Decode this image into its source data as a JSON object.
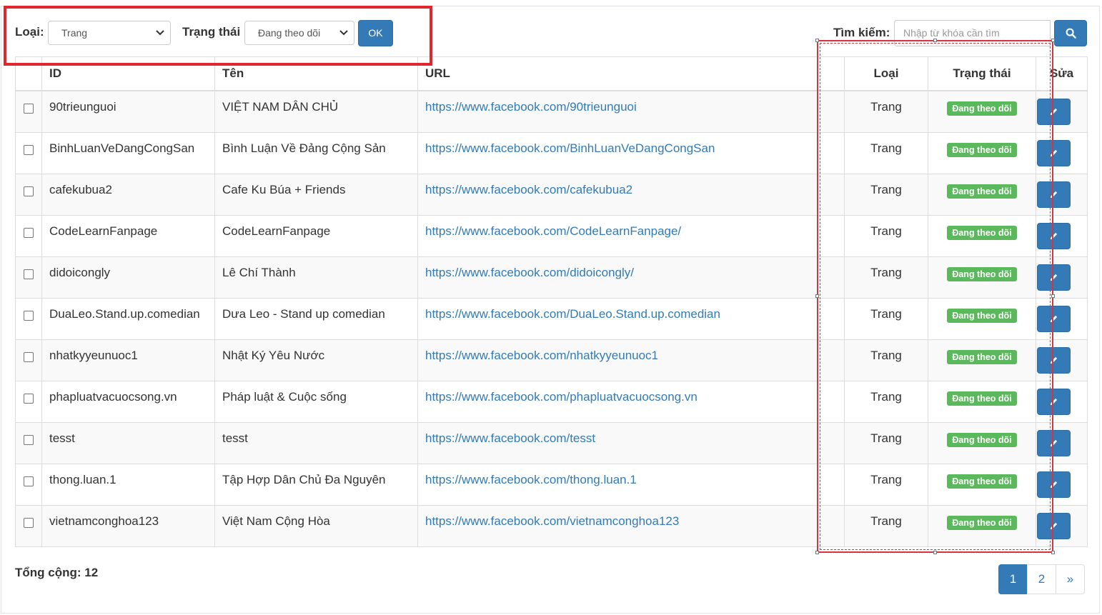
{
  "filters": {
    "type_label": "Loại:",
    "type_value": "Trang",
    "status_label": "Trạng thái",
    "status_value": "Đang theo dõi",
    "ok_label": "OK"
  },
  "search": {
    "label": "Tìm kiếm:",
    "placeholder": "Nhập từ khóa cần tìm"
  },
  "table": {
    "headers": {
      "id": "ID",
      "name": "Tên",
      "url": "URL",
      "type": "Loại",
      "status": "Trạng thái",
      "edit": "Sửa"
    },
    "rows": [
      {
        "id": "90trieunguoi",
        "name": "VIỆT NAM DÂN CHỦ",
        "url": "https://www.facebook.com/90trieunguoi",
        "type": "Trang",
        "status": "Đang theo dõi"
      },
      {
        "id": "BinhLuanVeDangCongSan",
        "name": "Bình Luận Về Đảng Cộng Sản",
        "url": "https://www.facebook.com/BinhLuanVeDangCongSan",
        "type": "Trang",
        "status": "Đang theo dõi"
      },
      {
        "id": "cafekubua2",
        "name": "Cafe Ku Búa + Friends",
        "url": "https://www.facebook.com/cafekubua2",
        "type": "Trang",
        "status": "Đang theo dõi"
      },
      {
        "id": "CodeLearnFanpage",
        "name": "CodeLearnFanpage",
        "url": "https://www.facebook.com/CodeLearnFanpage/",
        "type": "Trang",
        "status": "Đang theo dõi"
      },
      {
        "id": "didoicongly",
        "name": "Lê Chí Thành",
        "url": "https://www.facebook.com/didoicongly/",
        "type": "Trang",
        "status": "Đang theo dõi"
      },
      {
        "id": "DuaLeo.Stand.up.comedian",
        "name": "Dưa Leo - Stand up comedian",
        "url": "https://www.facebook.com/DuaLeo.Stand.up.comedian",
        "type": "Trang",
        "status": "Đang theo dõi"
      },
      {
        "id": "nhatkyyeunuoc1",
        "name": "Nhật Ký Yêu Nước",
        "url": "https://www.facebook.com/nhatkyyeunuoc1",
        "type": "Trang",
        "status": "Đang theo dõi"
      },
      {
        "id": "phapluatvacuocsong.vn",
        "name": "Pháp luật & Cuộc sống",
        "url": "https://www.facebook.com/phapluatvacuocsong.vn",
        "type": "Trang",
        "status": "Đang theo dõi"
      },
      {
        "id": "tesst",
        "name": "tesst",
        "url": "https://www.facebook.com/tesst",
        "type": "Trang",
        "status": "Đang theo dõi"
      },
      {
        "id": "thong.luan.1",
        "name": "Tập Hợp Dân Chủ Đa Nguyên",
        "url": "https://www.facebook.com/thong.luan.1",
        "type": "Trang",
        "status": "Đang theo dõi"
      },
      {
        "id": "vietnamconghoa123",
        "name": "Việt Nam Cộng Hòa",
        "url": "https://www.facebook.com/vietnamconghoa123",
        "type": "Trang",
        "status": "Đang theo dõi"
      }
    ]
  },
  "footer": {
    "total_label": "Tổng cộng: 12"
  },
  "pagination": {
    "pages": [
      "1",
      "2"
    ],
    "next": "»",
    "current": "1"
  },
  "colors": {
    "primary": "#337ab7",
    "success": "#5cb85c",
    "annotation_red": "#e3262e"
  },
  "icons": {
    "search": "search-icon",
    "edit": "pencil-icon",
    "dropdown": "chevron-down-icon"
  }
}
